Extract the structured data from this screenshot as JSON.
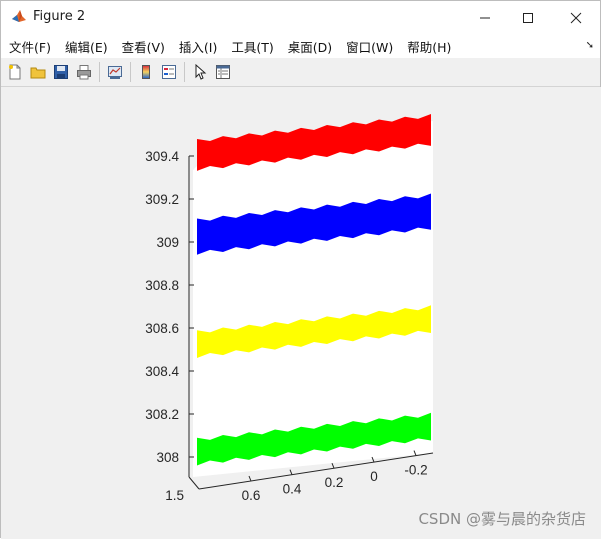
{
  "window": {
    "title": "Figure 2",
    "controls": {
      "minimize": "—",
      "maximize": "☐",
      "close": "✕"
    }
  },
  "menu": {
    "items": [
      "文件(F)",
      "编辑(E)",
      "查看(V)",
      "插入(I)",
      "工具(T)",
      "桌面(D)",
      "窗口(W)",
      "帮助(H)"
    ],
    "dock_glyph": "➘"
  },
  "toolbar": {
    "buttons": [
      "new-figure-icon",
      "open-file-icon",
      "save-icon",
      "print-icon",
      "link-plot-icon",
      "colorbar-icon",
      "legend-icon",
      "edit-plot-icon",
      "property-inspector-icon"
    ]
  },
  "watermark": "CSDN @雾与晨的杂货店",
  "chart_data": {
    "type": "scatter",
    "view": "3d",
    "z_ticks": [
      "308",
      "308.2",
      "308.4",
      "308.6",
      "308.8",
      "309",
      "309.2",
      "309.4"
    ],
    "x_ticks": [
      "0.6",
      "0.4",
      "0.2",
      "0",
      "-0.2"
    ],
    "y_ticks": [
      "1.5"
    ],
    "series": [
      {
        "color": "#ff0000",
        "z_range": [
          309.34,
          309.47
        ]
      },
      {
        "color": "#0000ff",
        "z_range": [
          308.95,
          309.1
        ]
      },
      {
        "color": "#ffff00",
        "z_range": [
          308.47,
          308.58
        ]
      },
      {
        "color": "#00ff00",
        "z_range": [
          307.97,
          308.08
        ]
      }
    ]
  }
}
